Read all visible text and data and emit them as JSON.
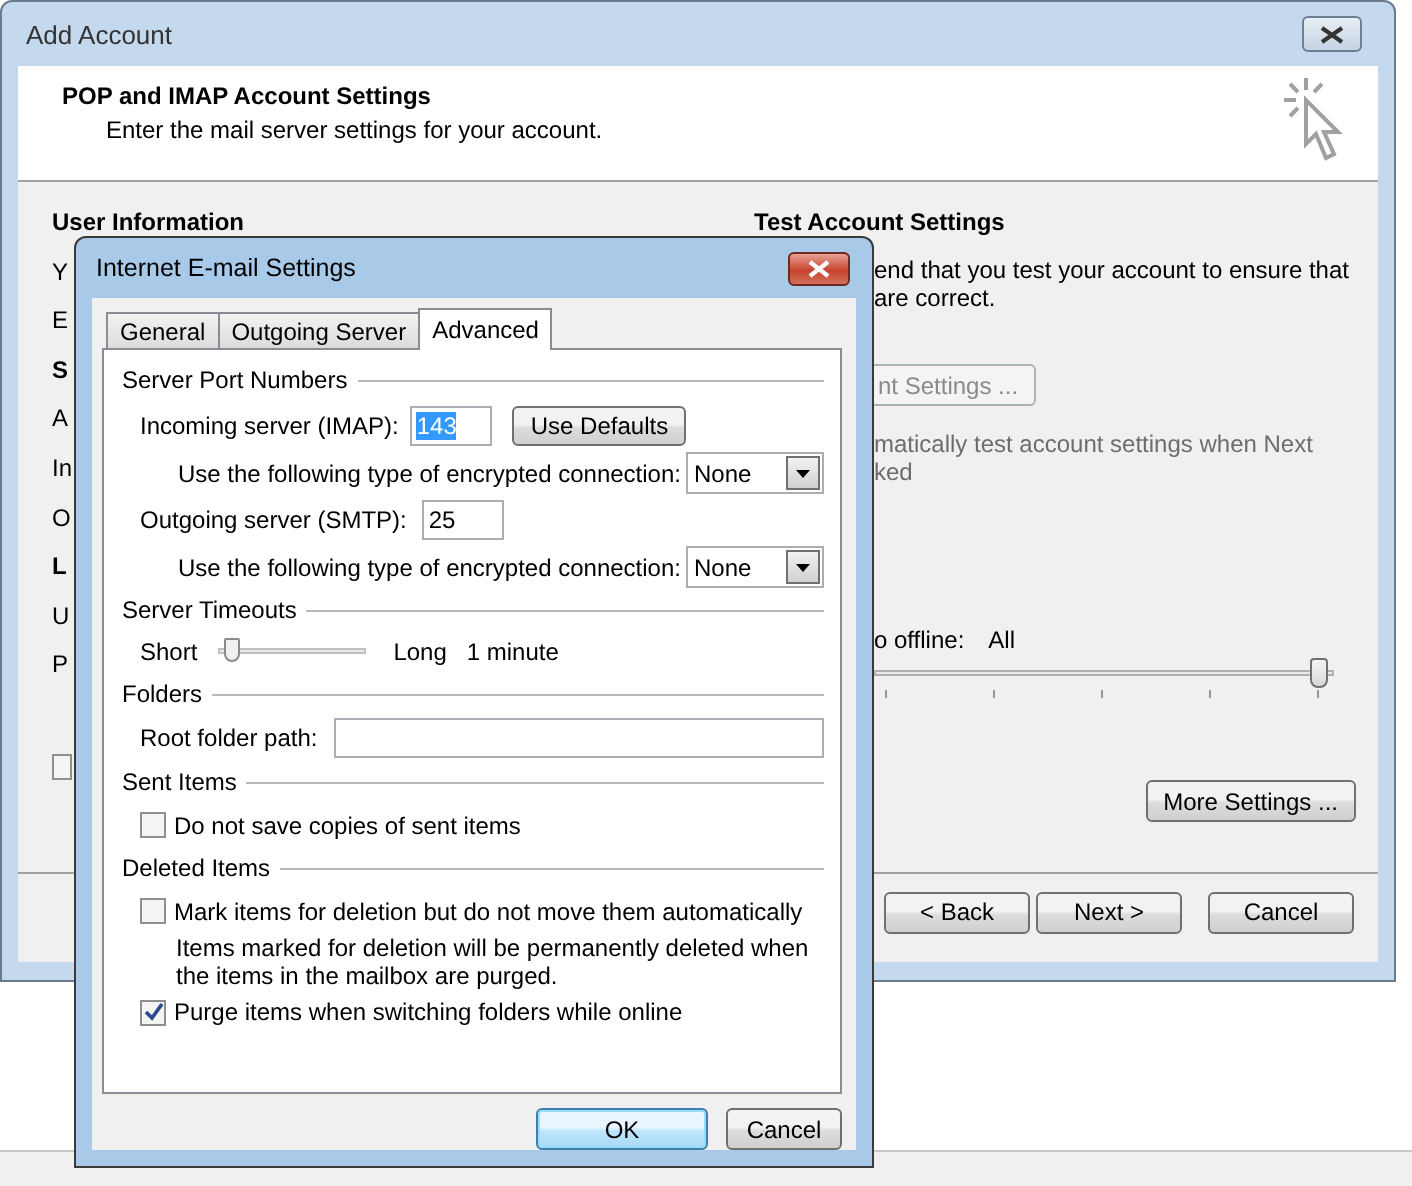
{
  "outer_window": {
    "title": "Add Account",
    "header": {
      "title": "POP and IMAP Account Settings",
      "subtitle": "Enter the mail server settings for your account."
    },
    "left_section": {
      "items": [
        {
          "kind": "heading",
          "text": "User Information"
        },
        {
          "kind": "label",
          "text": "Y"
        },
        {
          "kind": "label",
          "text": "E"
        },
        {
          "kind": "heading",
          "text": "S"
        },
        {
          "kind": "label",
          "text": "A"
        },
        {
          "kind": "label",
          "text": "In"
        },
        {
          "kind": "label",
          "text": "O"
        },
        {
          "kind": "heading",
          "text": "L"
        },
        {
          "kind": "label",
          "text": "U"
        },
        {
          "kind": "label",
          "text": "P"
        },
        {
          "kind": "checkbox",
          "checked": false
        }
      ]
    },
    "right_section": {
      "heading": "Test Account Settings",
      "description_lines": [
        "end that you test your account to ensure that",
        "are correct."
      ],
      "test_button": {
        "label": "nt Settings ...",
        "disabled": true
      },
      "auto_test": {
        "lines": [
          "matically test account settings when Next",
          "ked"
        ],
        "disabled": true
      },
      "offline": {
        "label": "o offline:",
        "value": "All",
        "level": 1
      },
      "more_settings_button": "More Settings ..."
    },
    "buttons": [
      {
        "label": "< Back"
      },
      {
        "label": "Next >"
      },
      {
        "label": "Cancel"
      }
    ]
  },
  "dialog": {
    "title": "Internet E-mail Settings",
    "tabs": [
      {
        "label": "General",
        "selected": false
      },
      {
        "label": "Outgoing Server",
        "selected": false
      },
      {
        "label": "Advanced",
        "selected": true
      }
    ],
    "sections": [
      {
        "title": "Server Port Numbers",
        "rows": [
          {
            "kind": "port",
            "label": "Incoming server (IMAP):",
            "value": "143",
            "selected_text": true,
            "button": "Use Defaults"
          },
          {
            "kind": "select",
            "label": "Use the following type of encrypted connection:",
            "value": "None"
          },
          {
            "kind": "port",
            "label": "Outgoing server (SMTP):",
            "value": "25",
            "selected_text": false
          },
          {
            "kind": "select",
            "label": "Use the following type of encrypted connection:",
            "value": "None"
          }
        ]
      },
      {
        "title": "Server Timeouts",
        "rows": [
          {
            "kind": "slider",
            "min_label": "Short",
            "max_label": "Long",
            "reading": "1 minute",
            "level": 0.1
          }
        ]
      },
      {
        "title": "Folders",
        "rows": [
          {
            "kind": "text",
            "label": "Root folder path:"
          }
        ]
      },
      {
        "title": "Sent Items",
        "rows": [
          {
            "kind": "checkbox",
            "label": "Do not save copies of sent items",
            "checked": false
          }
        ]
      },
      {
        "title": "Deleted Items",
        "rows": [
          {
            "kind": "checkbox",
            "label": "Mark items for deletion but do not move them automatically",
            "checked": false
          },
          {
            "kind": "note",
            "lines": [
              "Items marked for deletion will be permanently deleted when",
              "the items in the mailbox are purged."
            ]
          },
          {
            "kind": "checkbox",
            "label": "Purge items when switching folders while online",
            "checked": true
          }
        ]
      }
    ],
    "buttons": [
      {
        "label": "OK",
        "default": true
      },
      {
        "label": "Cancel",
        "default": false
      }
    ]
  }
}
